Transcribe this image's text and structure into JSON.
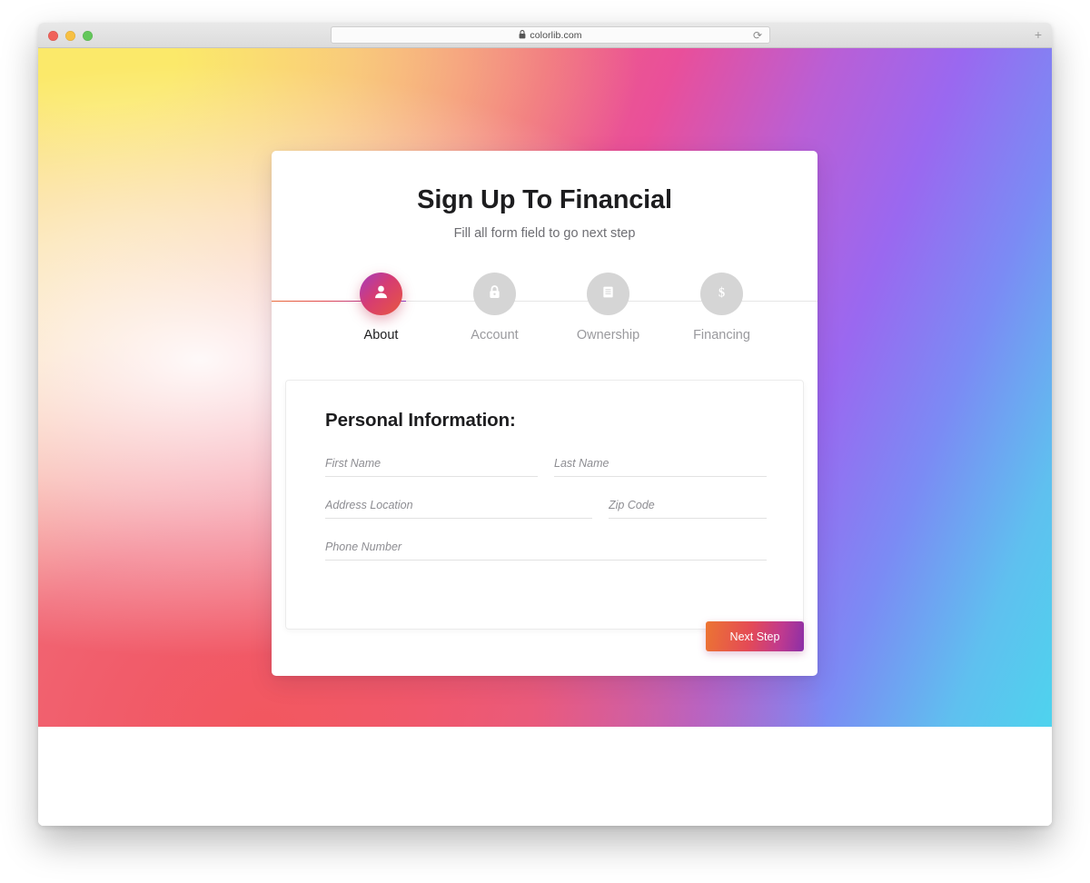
{
  "browser": {
    "url": "colorlib.com",
    "lock_icon": "lock-icon",
    "reload_icon": "reload-icon",
    "newtab_icon": "plus-icon",
    "traffic_lights": [
      "close-red",
      "minimize-yellow",
      "maximize-green"
    ]
  },
  "card": {
    "title": "Sign Up To Financial",
    "subtitle": "Fill all form field to go next step"
  },
  "stepper": {
    "active_index": 0,
    "steps": [
      {
        "label": "About",
        "icon": "user-icon",
        "active": true
      },
      {
        "label": "Account",
        "icon": "lock-icon",
        "active": false
      },
      {
        "label": "Ownership",
        "icon": "document-icon",
        "active": false
      },
      {
        "label": "Financing",
        "icon": "dollar-icon",
        "active": false
      }
    ]
  },
  "form": {
    "heading": "Personal Information:",
    "fields": [
      {
        "name": "first-name",
        "placeholder": "First Name",
        "value": ""
      },
      {
        "name": "last-name",
        "placeholder": "Last Name",
        "value": ""
      },
      {
        "name": "address-location",
        "placeholder": "Address Location",
        "value": ""
      },
      {
        "name": "zip-code",
        "placeholder": "Zip Code",
        "value": ""
      },
      {
        "name": "phone-number",
        "placeholder": "Phone Number",
        "value": ""
      }
    ]
  },
  "actions": {
    "next_label": "Next Step"
  },
  "colors": {
    "accent_start": "#ec7532",
    "accent_mid": "#e44a56",
    "accent_end": "#8a2fa8",
    "inactive_step": "#d5d5d5",
    "muted_text": "#9a9a9e"
  }
}
